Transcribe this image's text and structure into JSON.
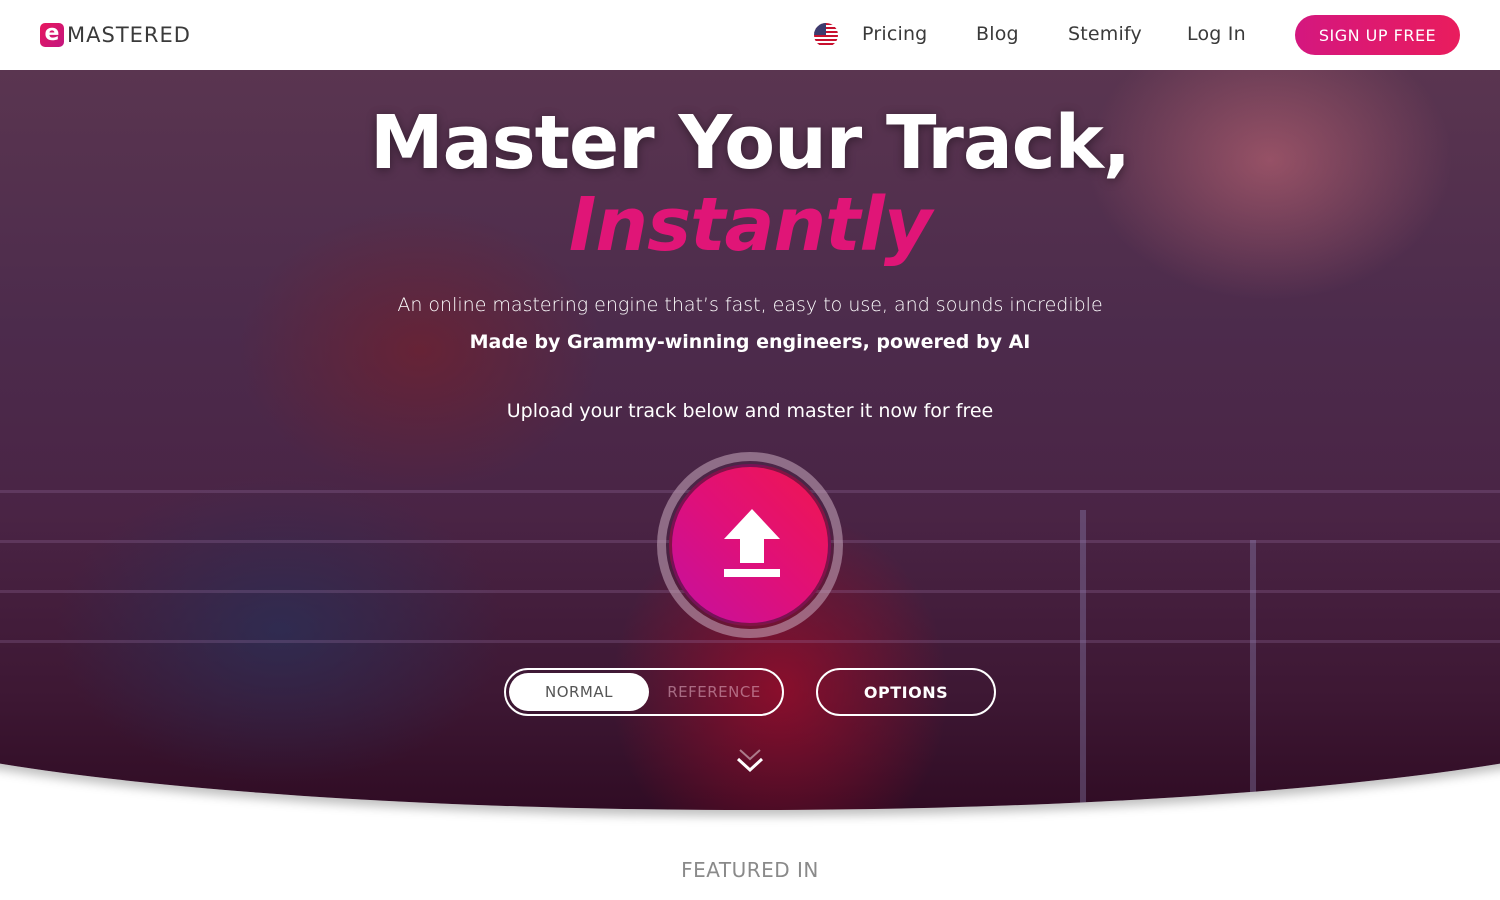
{
  "brand": {
    "logo_letter": "e",
    "name": "MASTERED",
    "accent_color": "#e01577"
  },
  "nav": {
    "language_icon": "us-flag-icon",
    "links": [
      {
        "label": "Pricing"
      },
      {
        "label": "Blog"
      },
      {
        "label": "Stemify"
      },
      {
        "label": "Log In"
      }
    ],
    "cta_label": "SIGN UP FREE"
  },
  "hero": {
    "title_line1": "Master Your Track,",
    "title_line2": "Instantly",
    "subtitle1": "An online mastering engine that’s fast, easy to use, and sounds incredible",
    "subtitle2": "Made by Grammy-winning engineers, powered by AI",
    "upload_prompt": "Upload your track below and master it now for free",
    "upload_icon": "upload-icon",
    "mode_toggle": {
      "options": [
        "NORMAL",
        "REFERENCE"
      ],
      "selected": "NORMAL"
    },
    "options_label": "OPTIONS",
    "scroll_icon": "double-chevron-down-icon"
  },
  "featured": {
    "heading": "FEATURED IN"
  }
}
